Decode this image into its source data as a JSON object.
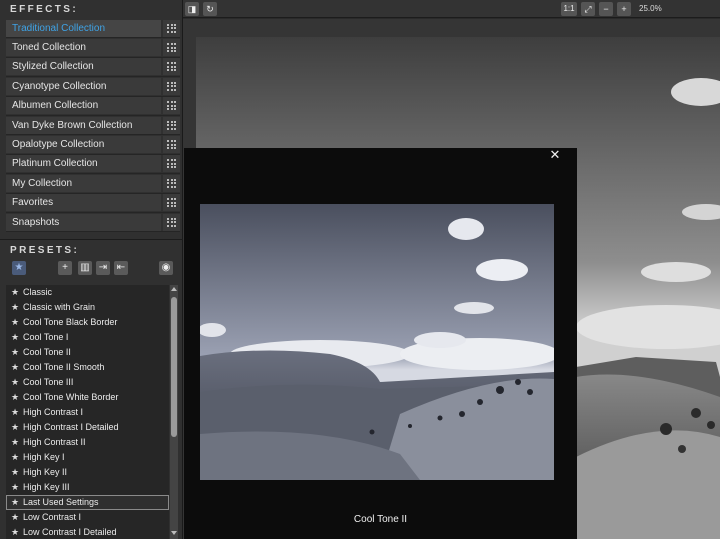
{
  "sidebar": {
    "effects_title": "EFFECTS:",
    "effects": [
      {
        "label": "Traditional Collection",
        "selected": true
      },
      {
        "label": "Toned Collection"
      },
      {
        "label": "Stylized Collection"
      },
      {
        "label": "Cyanotype Collection"
      },
      {
        "label": "Albumen Collection"
      },
      {
        "label": "Van Dyke Brown Collection"
      },
      {
        "label": "Opalotype Collection"
      },
      {
        "label": "Platinum Collection"
      },
      {
        "label": "My Collection"
      },
      {
        "label": "Favorites"
      },
      {
        "label": "Snapshots"
      }
    ],
    "presets_title": "PRESETS:",
    "presets": [
      {
        "label": "Classic"
      },
      {
        "label": "Classic with Grain"
      },
      {
        "label": "Cool Tone Black Border"
      },
      {
        "label": "Cool Tone I"
      },
      {
        "label": "Cool Tone II"
      },
      {
        "label": "Cool Tone II Smooth"
      },
      {
        "label": "Cool Tone III"
      },
      {
        "label": "Cool Tone White Border"
      },
      {
        "label": "High Contrast I"
      },
      {
        "label": "High Contrast I Detailed"
      },
      {
        "label": "High Contrast II"
      },
      {
        "label": "High Key I"
      },
      {
        "label": "High Key II"
      },
      {
        "label": "High Key III"
      },
      {
        "label": "Last Used Settings",
        "boxed": true
      },
      {
        "label": "Low Contrast I"
      },
      {
        "label": "Low Contrast I Detailed"
      }
    ]
  },
  "toolbar": {
    "actual_size_label": "1:1",
    "zoom_level": "25.0%"
  },
  "preview": {
    "caption": "Cool Tone II"
  },
  "colors": {
    "accent": "#3fa3e6"
  }
}
